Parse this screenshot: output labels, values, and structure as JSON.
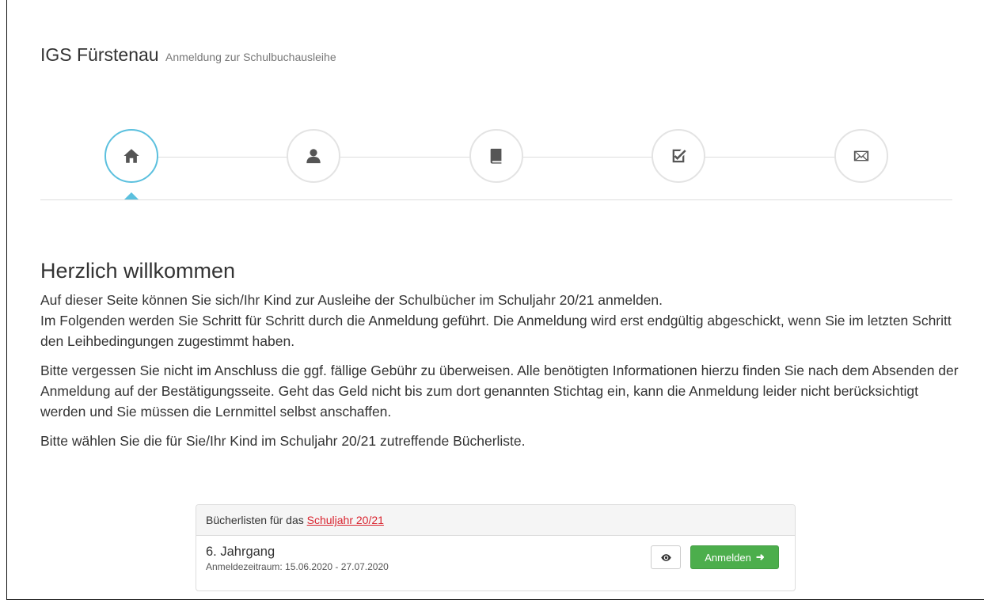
{
  "header": {
    "title": "IGS Fürstenau",
    "subtitle": "Anmeldung zur Schulbuchausleihe"
  },
  "wizard": {
    "steps": [
      {
        "icon": "home-icon",
        "active": true
      },
      {
        "icon": "user-icon",
        "active": false
      },
      {
        "icon": "book-icon",
        "active": false
      },
      {
        "icon": "check-square-icon",
        "active": false
      },
      {
        "icon": "envelope-icon",
        "active": false
      }
    ]
  },
  "content": {
    "heading": "Herzlich willkommen",
    "paragraph1_line1": "Auf dieser Seite können Sie sich/Ihr Kind zur Ausleihe der Schulbücher im Schuljahr 20/21 anmelden.",
    "paragraph1_line2": "Im Folgenden werden Sie Schritt für Schritt durch die Anmeldung geführt. Die Anmeldung wird erst endgültig abgeschickt, wenn Sie im letzten Schritt den Leihbedingungen zugestimmt haben.",
    "paragraph2": "Bitte vergessen Sie nicht im Anschluss die ggf. fällige Gebühr zu überweisen. Alle benötigten Informationen hierzu finden Sie nach dem Absenden der Anmeldung auf der Bestätigungsseite. Geht das Geld nicht bis zum dort genannten Stichtag ein, kann die Anmeldung leider nicht berücksichtigt werden und Sie müssen die Lernmittel selbst anschaffen.",
    "paragraph3": "Bitte wählen Sie die für Sie/Ihr Kind im Schuljahr 20/21 zutreffende Bücherliste."
  },
  "booklists": {
    "heading_prefix": "Bücherlisten für das",
    "heading_link": "Schuljahr 20/21",
    "items": [
      {
        "grade": "6. Jahrgang",
        "period": "Anmeldezeitraum: 15.06.2020 - 27.07.2020",
        "view_icon": "eye-icon",
        "register_label": "Anmelden",
        "register_icon": "arrow-right-icon"
      }
    ]
  },
  "colors": {
    "accent": "#5bc0de",
    "success": "#4cae4c",
    "link": "#d9232e"
  }
}
